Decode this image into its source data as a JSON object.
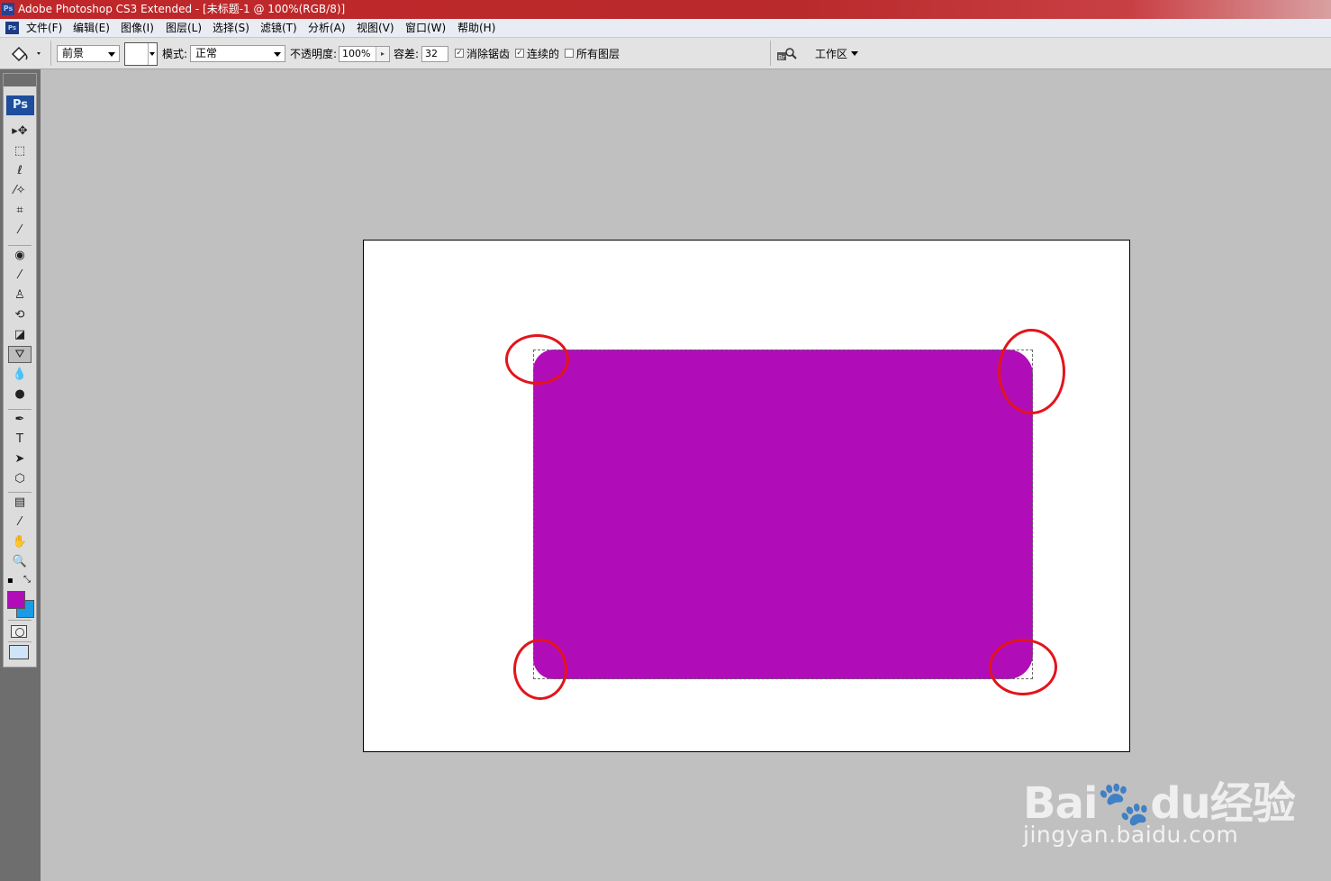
{
  "window": {
    "title": "Adobe Photoshop CS3 Extended - [未标题-1 @ 100%(RGB/8)]",
    "logo": "Ps"
  },
  "menu": [
    "文件(F)",
    "编辑(E)",
    "图像(I)",
    "图层(L)",
    "选择(S)",
    "滤镜(T)",
    "分析(A)",
    "视图(V)",
    "窗口(W)",
    "帮助(H)"
  ],
  "options": {
    "fill_source": "前景",
    "mode_label": "模式:",
    "mode_value": "正常",
    "opacity_label": "不透明度:",
    "opacity_value": "100%",
    "tolerance_label": "容差:",
    "tolerance_value": "32",
    "anti_alias_label": "消除锯齿",
    "anti_alias_checked": true,
    "contiguous_label": "连续的",
    "contiguous_checked": true,
    "all_layers_label": "所有图层",
    "all_layers_checked": false,
    "workspace_label": "工作区"
  },
  "toolbox": {
    "badge": "Ps",
    "tools": [
      {
        "name": "move-tool",
        "icon": "move-icon",
        "glyph": "▸✥"
      },
      {
        "name": "marquee-tool",
        "icon": "rect-marquee-icon",
        "glyph": "⬚"
      },
      {
        "name": "lasso-tool",
        "icon": "lasso-icon",
        "glyph": "ℓ"
      },
      {
        "name": "magic-wand-tool",
        "icon": "magic-wand-icon",
        "glyph": "⁄✧"
      },
      {
        "name": "crop-tool",
        "icon": "crop-icon",
        "glyph": "⌗"
      },
      {
        "name": "slice-tool",
        "icon": "slice-icon",
        "glyph": "⁄"
      },
      {
        "name": "healing-tool",
        "icon": "healing-icon",
        "glyph": "◉"
      },
      {
        "name": "brush-tool",
        "icon": "brush-icon",
        "glyph": "⁄"
      },
      {
        "name": "stamp-tool",
        "icon": "stamp-icon",
        "glyph": "♙"
      },
      {
        "name": "history-brush-tool",
        "icon": "history-brush-icon",
        "glyph": "⟲"
      },
      {
        "name": "eraser-tool",
        "icon": "eraser-icon",
        "glyph": "◪"
      },
      {
        "name": "paint-bucket-tool",
        "icon": "paint-bucket-icon",
        "glyph": "⛛",
        "active": true
      },
      {
        "name": "blur-tool",
        "icon": "blur-icon",
        "glyph": "💧"
      },
      {
        "name": "dodge-tool",
        "icon": "dodge-icon",
        "glyph": "●"
      },
      {
        "name": "pen-tool",
        "icon": "pen-icon",
        "glyph": "✒"
      },
      {
        "name": "type-tool",
        "icon": "type-icon",
        "glyph": "T"
      },
      {
        "name": "path-selection-tool",
        "icon": "path-selection-icon",
        "glyph": "➤"
      },
      {
        "name": "shape-tool",
        "icon": "shape-icon",
        "glyph": "⬡"
      },
      {
        "name": "notes-tool",
        "icon": "notes-icon",
        "glyph": "▤"
      },
      {
        "name": "eyedropper-tool",
        "icon": "eyedropper-icon",
        "glyph": "⁄"
      },
      {
        "name": "hand-tool",
        "icon": "hand-icon",
        "glyph": "✋"
      },
      {
        "name": "zoom-tool",
        "icon": "zoom-icon",
        "glyph": "🔍"
      }
    ],
    "foreground_color": "#b00db9",
    "background_color": "#1a9be3"
  },
  "canvas": {
    "shape_color": "#b00db9",
    "annotation_color": "#e3141b"
  },
  "watermark": {
    "logo": "Bai🐾du经验",
    "url": "jingyan.baidu.com"
  }
}
